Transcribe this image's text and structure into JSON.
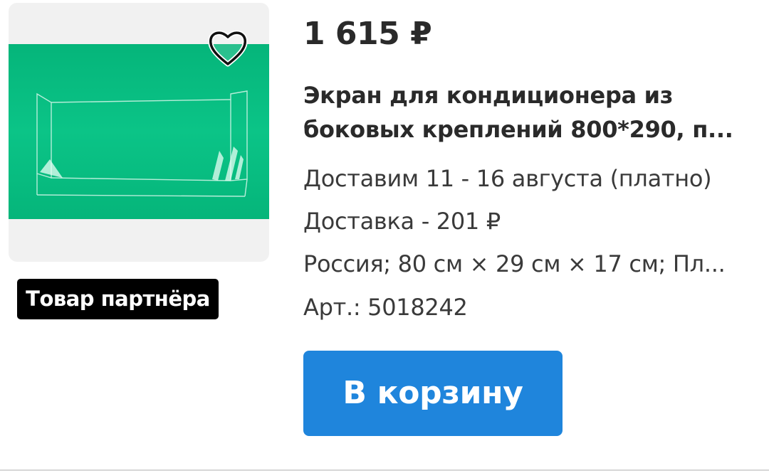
{
  "product": {
    "price": "1 615 ₽",
    "title_line1": "Экран для кондиционера из",
    "title_line2": "боковых креплений 800*290, п...",
    "delivery_date": "Доставим 11 - 16 августа (платно)",
    "delivery_price": "Доставка - 201 ₽",
    "specs": "Россия; 80 см × 29 см × 17 см; Пл...",
    "article": "Арт.: 5018242",
    "partner_badge": "Товар партнёра",
    "image_background_color": "#0ac184"
  },
  "actions": {
    "cart_label": "В корзину",
    "cart_color": "#1f85dc",
    "favorite_icon": "heart-outline-icon"
  }
}
